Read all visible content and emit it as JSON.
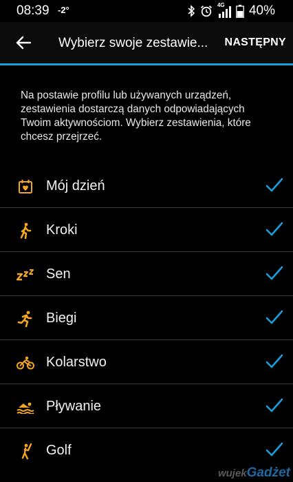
{
  "statusbar": {
    "time": "08:39",
    "temperature": "-2°",
    "network": "4G",
    "battery": "40%"
  },
  "appbar": {
    "title": "Wybierz swoje zestawie...",
    "next_label": "NASTĘPNY",
    "accent_color": "#17a0dc"
  },
  "description": "Na postawie profilu lub używanych urządzeń, zestawienia dostarczą danych odpowiadających Twoim aktywnościom. Wybierz zestawienia, które chcesz przejrzeć.",
  "items": [
    {
      "label": "Mój dzień",
      "icon": "calendar-heart-icon",
      "checked": true
    },
    {
      "label": "Kroki",
      "icon": "walking-icon",
      "checked": true
    },
    {
      "label": "Sen",
      "icon": "sleep-zzz-icon",
      "checked": true
    },
    {
      "label": "Biegi",
      "icon": "running-icon",
      "checked": true
    },
    {
      "label": "Kolarstwo",
      "icon": "bicycle-icon",
      "checked": true
    },
    {
      "label": "Pływanie",
      "icon": "swimming-icon",
      "checked": true
    },
    {
      "label": "Golf",
      "icon": "golf-icon",
      "checked": true
    }
  ],
  "colors": {
    "icon": "#f5a623",
    "check": "#17a0dc"
  },
  "watermark": {
    "prefix": "wujek",
    "brand": "Gadżet"
  }
}
